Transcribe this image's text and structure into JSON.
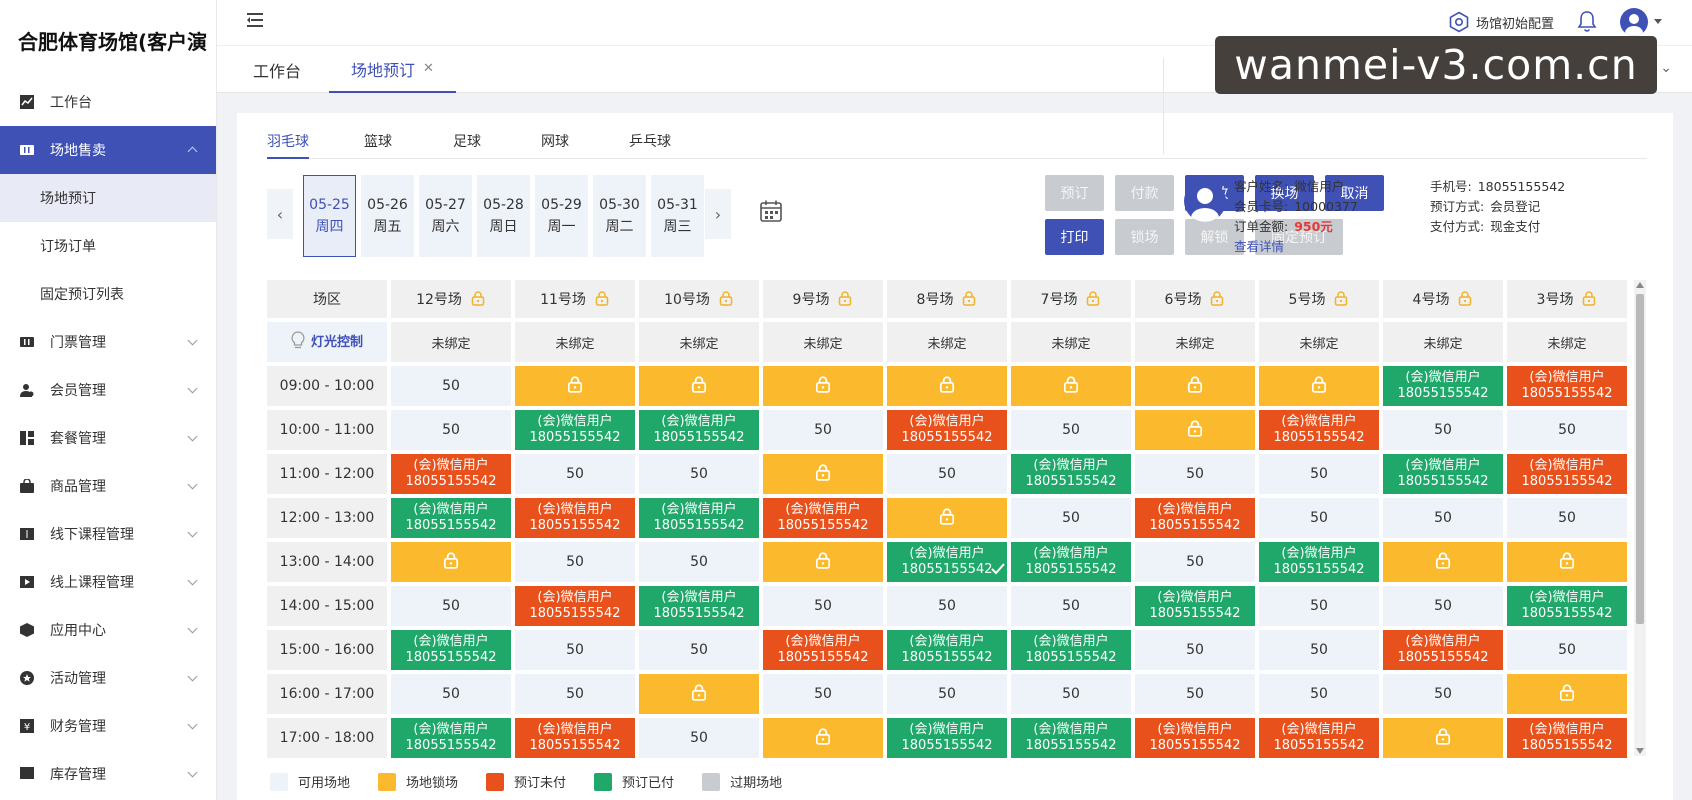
{
  "app": {
    "title": "合肥体育场馆(客户演"
  },
  "sidebar": {
    "items": [
      {
        "label": "工作台",
        "icon": "chart-line-icon"
      },
      {
        "label": "场地售卖",
        "icon": "ticket-icon",
        "expanded": true
      },
      {
        "label": "门票管理",
        "icon": "ticket-icon"
      },
      {
        "label": "会员管理",
        "icon": "user-icon"
      },
      {
        "label": "套餐管理",
        "icon": "grid-icon"
      },
      {
        "label": "商品管理",
        "icon": "bag-icon"
      },
      {
        "label": "线下课程管理",
        "icon": "book-icon"
      },
      {
        "label": "线上课程管理",
        "icon": "play-icon"
      },
      {
        "label": "应用中心",
        "icon": "cube-icon"
      },
      {
        "label": "活动管理",
        "icon": "star-icon"
      },
      {
        "label": "财务管理",
        "icon": "yen-icon"
      },
      {
        "label": "库存管理",
        "icon": "box-icon"
      }
    ],
    "subitems": [
      {
        "label": "场地预订",
        "selected": true
      },
      {
        "label": "订场订单"
      },
      {
        "label": "固定预订列表"
      }
    ]
  },
  "topbar": {
    "config_label": "场馆初始配置"
  },
  "tabs": [
    {
      "label": "工作台"
    },
    {
      "label": "场地预订",
      "active": true
    }
  ],
  "watermark": "wanmei-v3.com.cn",
  "sports": [
    "羽毛球",
    "篮球",
    "足球",
    "网球",
    "乒乓球"
  ],
  "dates": [
    {
      "date": "05-25",
      "day": "周四",
      "active": true
    },
    {
      "date": "05-26",
      "day": "周五"
    },
    {
      "date": "05-27",
      "day": "周六"
    },
    {
      "date": "05-28",
      "day": "周日"
    },
    {
      "date": "05-29",
      "day": "周一"
    },
    {
      "date": "05-30",
      "day": "周二"
    },
    {
      "date": "05-31",
      "day": "周三"
    }
  ],
  "ops": {
    "book": "预订",
    "pay": "付款",
    "edit": "修改",
    "swap": "换场",
    "cancel": "取消",
    "print": "打印",
    "lock": "锁场",
    "unlock": "解锁",
    "fixed": "固定预订"
  },
  "customer": {
    "name_label": "客户姓名:",
    "name": "微信用户",
    "phone_label": "手机号:",
    "phone": "18055155542",
    "card_label": "会员卡号:",
    "card": "10000377",
    "method_label": "预订方式:",
    "method": "会员登记",
    "amount_label": "订单金额:",
    "amount": "950元",
    "pay_label": "支付方式:",
    "pay": "现金支付",
    "details_link": "查看详情"
  },
  "grid": {
    "corner": "场区",
    "light_label": "灯光控制",
    "unbound": "未绑定",
    "courts": [
      "12号场",
      "11号场",
      "10号场",
      "9号场",
      "8号场",
      "7号场",
      "6号场",
      "5号场",
      "4号场",
      "3号场"
    ],
    "booking_name": "(会)微信用户",
    "booking_phone": "18055155542",
    "rows": [
      {
        "time": "09:00 - 10:00",
        "cells": [
          "50",
          "L",
          "L",
          "L",
          "L",
          "L",
          "L",
          "L",
          "P",
          "U"
        ]
      },
      {
        "time": "10:00 - 11:00",
        "cells": [
          "50",
          "P",
          "P",
          "50",
          "U",
          "50",
          "L",
          "U",
          "50",
          "50"
        ]
      },
      {
        "time": "11:00 - 12:00",
        "cells": [
          "U",
          "50",
          "50",
          "L",
          "50",
          "P",
          "50",
          "50",
          "P",
          "U"
        ]
      },
      {
        "time": "12:00 - 13:00",
        "cells": [
          "P",
          "U",
          "P",
          "U",
          "L",
          "50",
          "U",
          "50",
          "50",
          "50"
        ]
      },
      {
        "time": "13:00 - 14:00",
        "cells": [
          "L",
          "50",
          "50",
          "L",
          "P",
          "P",
          "50",
          "P",
          "L",
          "L"
        ]
      },
      {
        "time": "14:00 - 15:00",
        "cells": [
          "50",
          "U",
          "P",
          "50",
          "50",
          "50",
          "P",
          "50",
          "50",
          "P"
        ]
      },
      {
        "time": "15:00 - 16:00",
        "cells": [
          "P",
          "50",
          "50",
          "U",
          "P",
          "P",
          "50",
          "50",
          "U",
          "50"
        ]
      },
      {
        "time": "16:00 - 17:00",
        "cells": [
          "50",
          "50",
          "L",
          "50",
          "50",
          "50",
          "50",
          "50",
          "50",
          "L"
        ]
      },
      {
        "time": "17:00 - 18:00",
        "cells": [
          "P",
          "U",
          "50",
          "L",
          "P",
          "P",
          "U",
          "U",
          "L",
          "U"
        ]
      }
    ]
  },
  "legend": [
    {
      "label": "可用场地",
      "color": "#eef3f9"
    },
    {
      "label": "场地锁场",
      "color": "#fbba2e"
    },
    {
      "label": "预订未付",
      "color": "#e8511b"
    },
    {
      "label": "预订已付",
      "color": "#1fa86a"
    },
    {
      "label": "过期场地",
      "color": "#c8cbd0"
    }
  ]
}
